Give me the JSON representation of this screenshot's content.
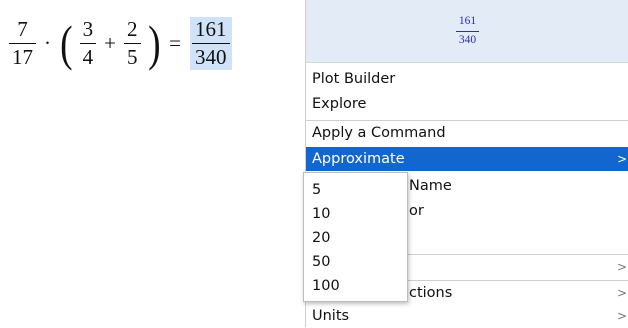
{
  "expression": {
    "f1": {
      "num": "7",
      "den": "17"
    },
    "dot": "·",
    "lparen": "(",
    "f2": {
      "num": "3",
      "den": "4"
    },
    "plus": "+",
    "f3": {
      "num": "2",
      "den": "5"
    },
    "rparen": ")",
    "equals": "=",
    "result": {
      "num": "161",
      "den": "340"
    }
  },
  "menu": {
    "preview": {
      "num": "161",
      "den": "340"
    },
    "items": [
      {
        "label": "Plot Builder",
        "arrow": ""
      },
      {
        "label": "Explore",
        "arrow": ""
      },
      {
        "label": "Apply a Command",
        "arrow": ""
      },
      {
        "label": "Approximate",
        "arrow": ">"
      },
      {
        "label": "Name",
        "arrow": ""
      },
      {
        "label": "or",
        "arrow": ""
      },
      {
        "label": "",
        "arrow": ">"
      },
      {
        "label": "ctions",
        "arrow": ">"
      },
      {
        "label": "Units",
        "arrow": ">"
      }
    ]
  },
  "submenu": {
    "options": [
      "5",
      "10",
      "20",
      "50",
      "100"
    ]
  }
}
